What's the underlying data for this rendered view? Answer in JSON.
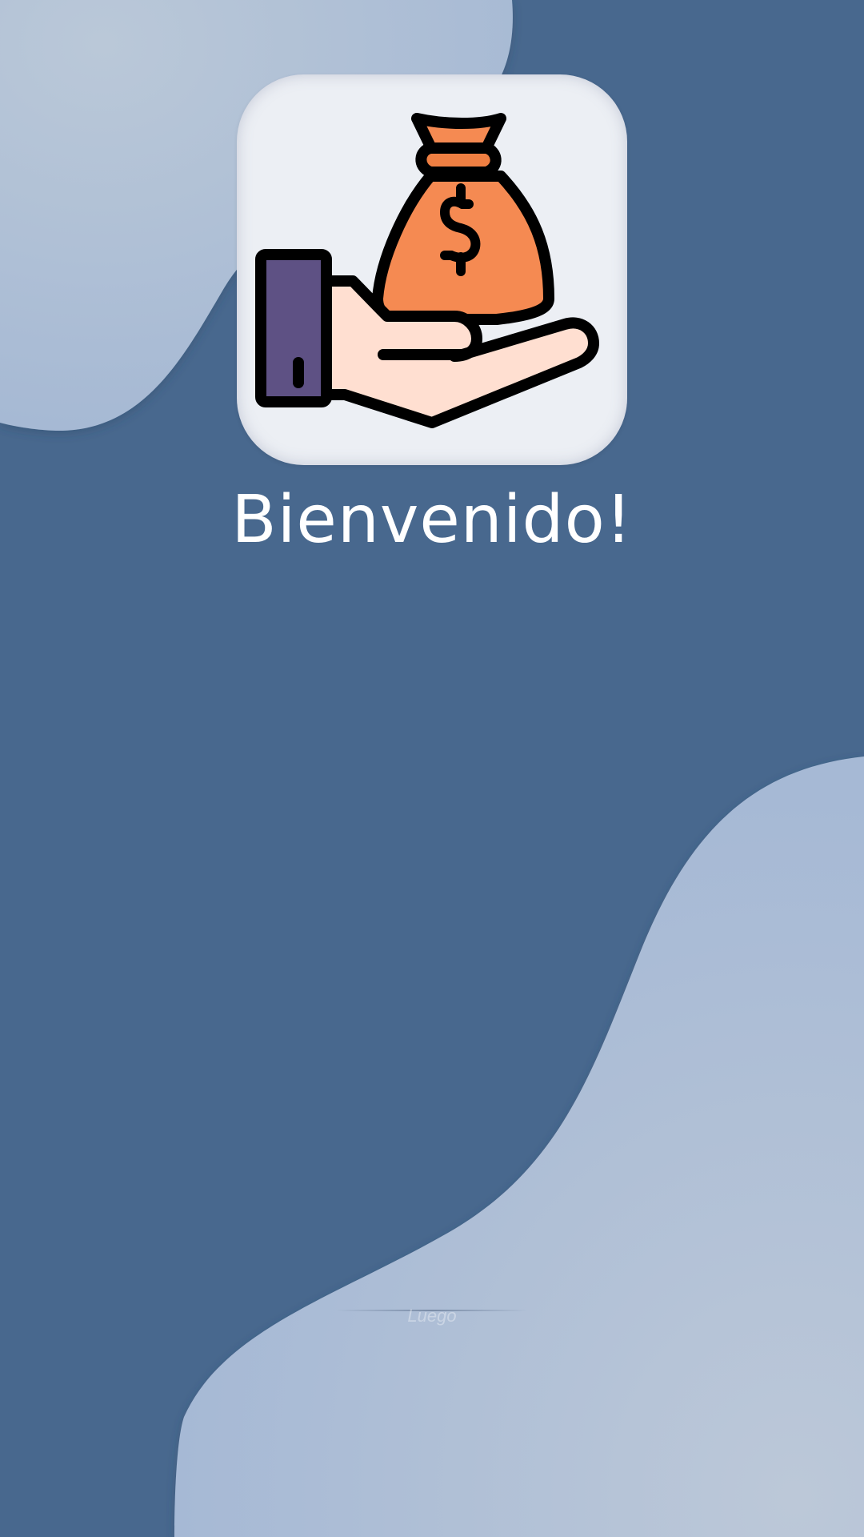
{
  "screen": {
    "welcome_text": "Bienvenido!",
    "faint_label": "Luego"
  },
  "logo": {
    "icon": "hand-holding-money-bag-icon",
    "symbol": "$"
  },
  "colors": {
    "background": "#48688e",
    "blob_light": "#a9bcd6",
    "card": "#eceff4",
    "bag": "#f58a52",
    "bag_band": "#ef7f42",
    "sleeve": "#5e5184",
    "skin": "#ffdfd1",
    "text": "#ffffff"
  }
}
